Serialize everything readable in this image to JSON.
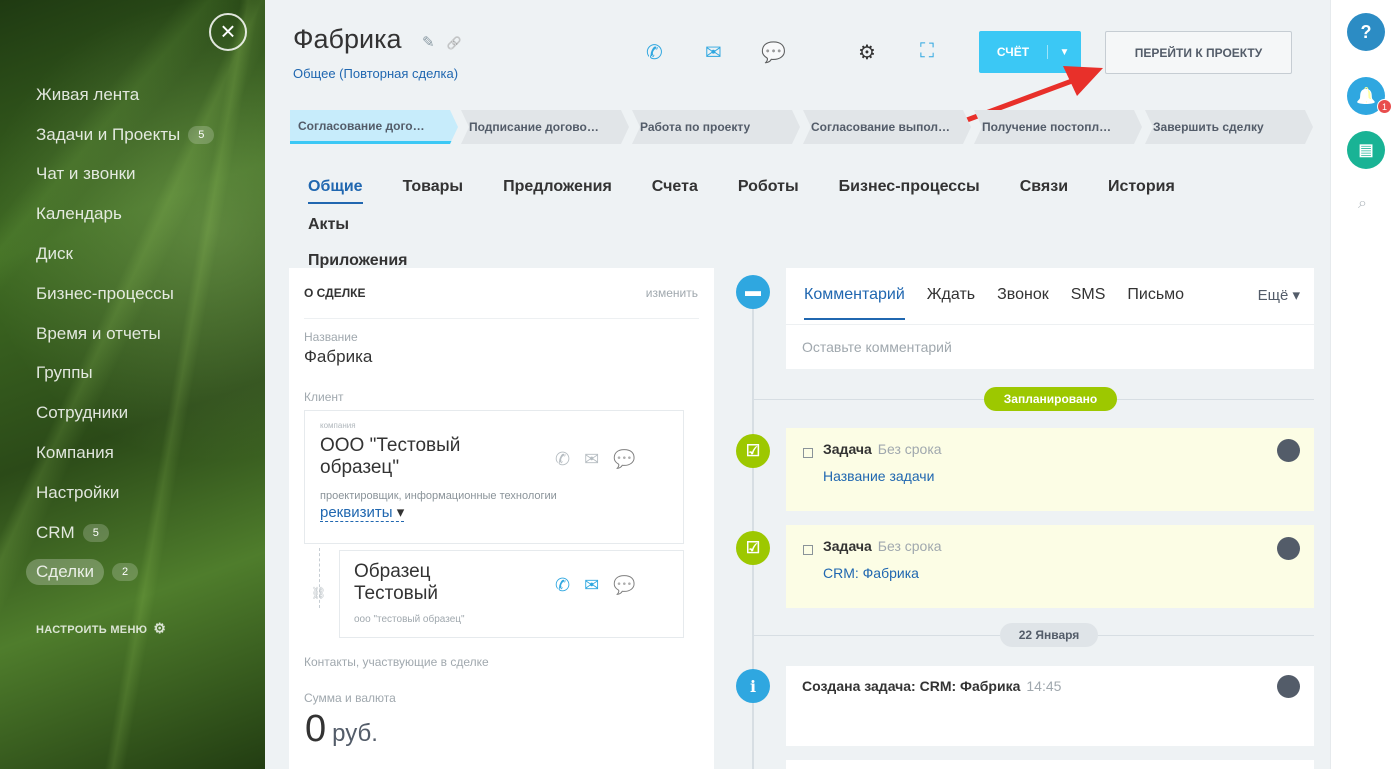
{
  "sidebar": {
    "close_icon": "×",
    "items": [
      {
        "label": "Живая лента",
        "count": ""
      },
      {
        "label": "Задачи и Проекты",
        "count": "5"
      },
      {
        "label": "Чат и звонки",
        "count": ""
      },
      {
        "label": "Календарь",
        "count": ""
      },
      {
        "label": "Диск",
        "count": ""
      },
      {
        "label": "Бизнес-процессы",
        "count": ""
      },
      {
        "label": "Время и отчеты",
        "count": ""
      },
      {
        "label": "Группы",
        "count": ""
      },
      {
        "label": "Сотрудники",
        "count": ""
      },
      {
        "label": "Компания",
        "count": ""
      },
      {
        "label": "Настройки",
        "count": ""
      },
      {
        "label": "CRM",
        "count": "5"
      },
      {
        "label": "Сделки",
        "count": "2"
      }
    ],
    "settings_label": "НАСТРОИТЬ МЕНЮ",
    "settings_icon": "⚙"
  },
  "header": {
    "title": "Фабрика",
    "edit_icon": "✎",
    "link_icon": "🔗",
    "subtitle": "Общее (Повторная сделка)",
    "icons": {
      "phone": "✆",
      "mail": "✉",
      "chat": "💬",
      "gear": "⚙",
      "scan": "⛶"
    },
    "invoice_label": "СЧЁТ",
    "invoice_arrow": "▼",
    "project_label": "ПЕРЕЙТИ К ПРОЕКТУ"
  },
  "stages": [
    "Согласование дого…",
    "Подписание догово…",
    "Работа по проекту",
    "Согласование выпол…",
    "Получение постопл…",
    "Завершить сделку"
  ],
  "tabs": [
    "Общие",
    "Товары",
    "Предложения",
    "Счета",
    "Роботы",
    "Бизнес-процессы",
    "Связи",
    "История",
    "Акты",
    "Приложения"
  ],
  "deal": {
    "heading": "О СДЕЛКЕ",
    "edit": "изменить",
    "name_label": "Название",
    "name_value": "Фабрика",
    "client_label": "Клиент",
    "company": {
      "type": "компания",
      "name": "ООО \"Тестовый образец\"",
      "desc": "проектировщик, информационные технологии",
      "requisites": "реквизиты",
      "req_arrow": "▾"
    },
    "contact": {
      "name": "Образец Тестовый",
      "desc": "ооо \"тестовый образец\""
    },
    "contacts_label": "Контакты, участвующие в сделке",
    "sum_label": "Сумма и валюта",
    "sum_value": "0",
    "currency": "руб."
  },
  "timeline": {
    "comment_tabs": [
      "Комментарий",
      "Ждать",
      "Звонок",
      "SMS",
      "Письмо"
    ],
    "more": "Ещё ▾",
    "comment_placeholder": "Оставьте комментарий",
    "planned_badge": "Запланировано",
    "tasks": [
      {
        "title": "Задача",
        "deadline": "Без срока",
        "link": "Название задачи"
      },
      {
        "title": "Задача",
        "deadline": "Без срока",
        "link": "CRM: Фабрика"
      }
    ],
    "date_badge": "22 Января",
    "event": {
      "title": "Создана задача: CRM: Фабрика",
      "time": "14:45"
    }
  },
  "rail": {
    "help": "?",
    "bell": "🔔",
    "notif_count": "1",
    "chat": "▤",
    "search": "⌕"
  },
  "colors": {
    "accent": "#2067b0",
    "button": "#3bc8f5",
    "green": "#9dc800",
    "arrow": "#e8302a"
  }
}
